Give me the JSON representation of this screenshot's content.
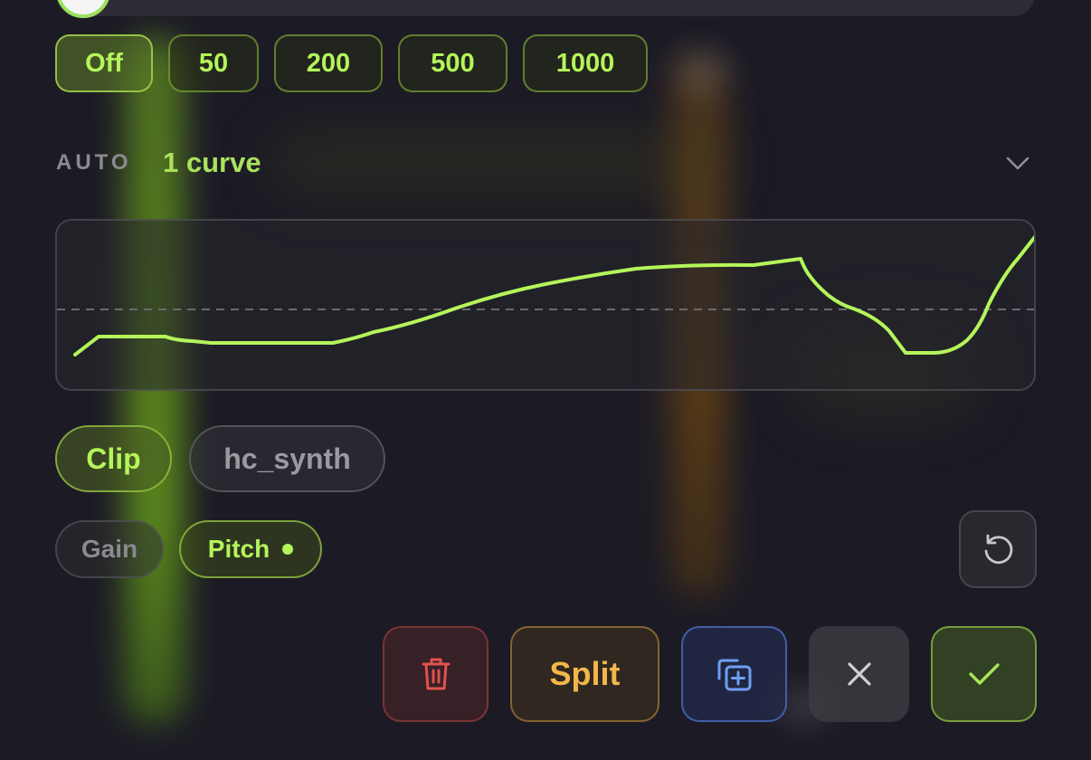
{
  "presets": [
    "Off",
    "50",
    "200",
    "500",
    "1000"
  ],
  "automation": {
    "label": "AUTO",
    "curve_count": "1 curve"
  },
  "targets": {
    "clip": "Clip",
    "track": "hc_synth"
  },
  "params": {
    "gain": "Gain",
    "pitch": "Pitch"
  },
  "actions": {
    "split": "Split"
  },
  "icons": {
    "collapse": "chevron-down-icon",
    "reset": "reset-icon",
    "delete": "trash-icon",
    "duplicate": "duplicate-icon",
    "cancel": "close-icon",
    "confirm": "check-icon"
  },
  "colors": {
    "accent": "#b4f55a",
    "curve": "#b4f55a",
    "delete": "#e0524f",
    "split": "#f2b64a",
    "duplicate": "#6f9ff2",
    "confirm": "#a6e55a"
  }
}
